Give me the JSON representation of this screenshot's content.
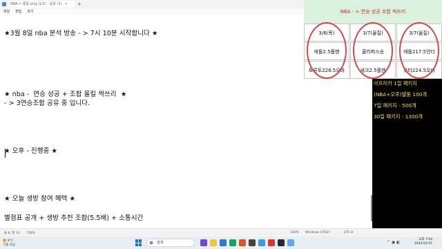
{
  "window": {
    "tab_title": "NBA > 통합.png (1/2) - 등장 (2)",
    "menu": [
      "파일",
      "편집",
      "보기"
    ]
  },
  "editor": {
    "lines": [
      "★3월 8일 nba 분석 방송 - > 7시 10분 시작합니다 ★",
      "★ nba -  연승 성공 + 조합 올킬 싹쓰리  ★",
      "- > 3연승조합 공유 중 입니다.",
      "★ 오후 - 진행중 ★",
      "★ 오늘 생방 참여 혜택 ★",
      "별점표 공개 + 생방 추천 조합(5.5배) + 소통시간"
    ]
  },
  "status_bar": {
    "position": "줄 8, 열 13",
    "chars": "739자",
    "zoom": "140%",
    "line_ending": "Windows (CRLF)",
    "encoding": "UTF-8"
  },
  "results": {
    "title": "NBA - > 연승 성공  조합 싹쓰리",
    "dates": [
      "3/6(목)",
      "3/7(올킬)",
      "3/7(올킬)"
    ],
    "row1": [
      "애틀2.5플핸",
      "클리퍼스승",
      "애틀217.5언더"
    ],
    "row2": [
      "토론토228.5오바",
      "새크2.5플핸",
      "유타224.5오바"
    ],
    "colors": {
      "title_bg": "#d9f1dd",
      "title_text": "#c52a2a",
      "circle": "#d94646"
    }
  },
  "packages": {
    "items": [
      "아프리카 1일 패키지",
      "(NBA+오후)별풍 100개",
      "7일 패키지 - 500개",
      "30일 패키지 - 1300개"
    ],
    "colors": {
      "bg": "#000000",
      "text": "#f4e04a"
    }
  },
  "taskbar": {
    "weather": {
      "temp": "8°C",
      "desc": "구름 조금"
    },
    "search_placeholder": "검색",
    "time": "오후 7:04",
    "date": "2024-03-07"
  }
}
